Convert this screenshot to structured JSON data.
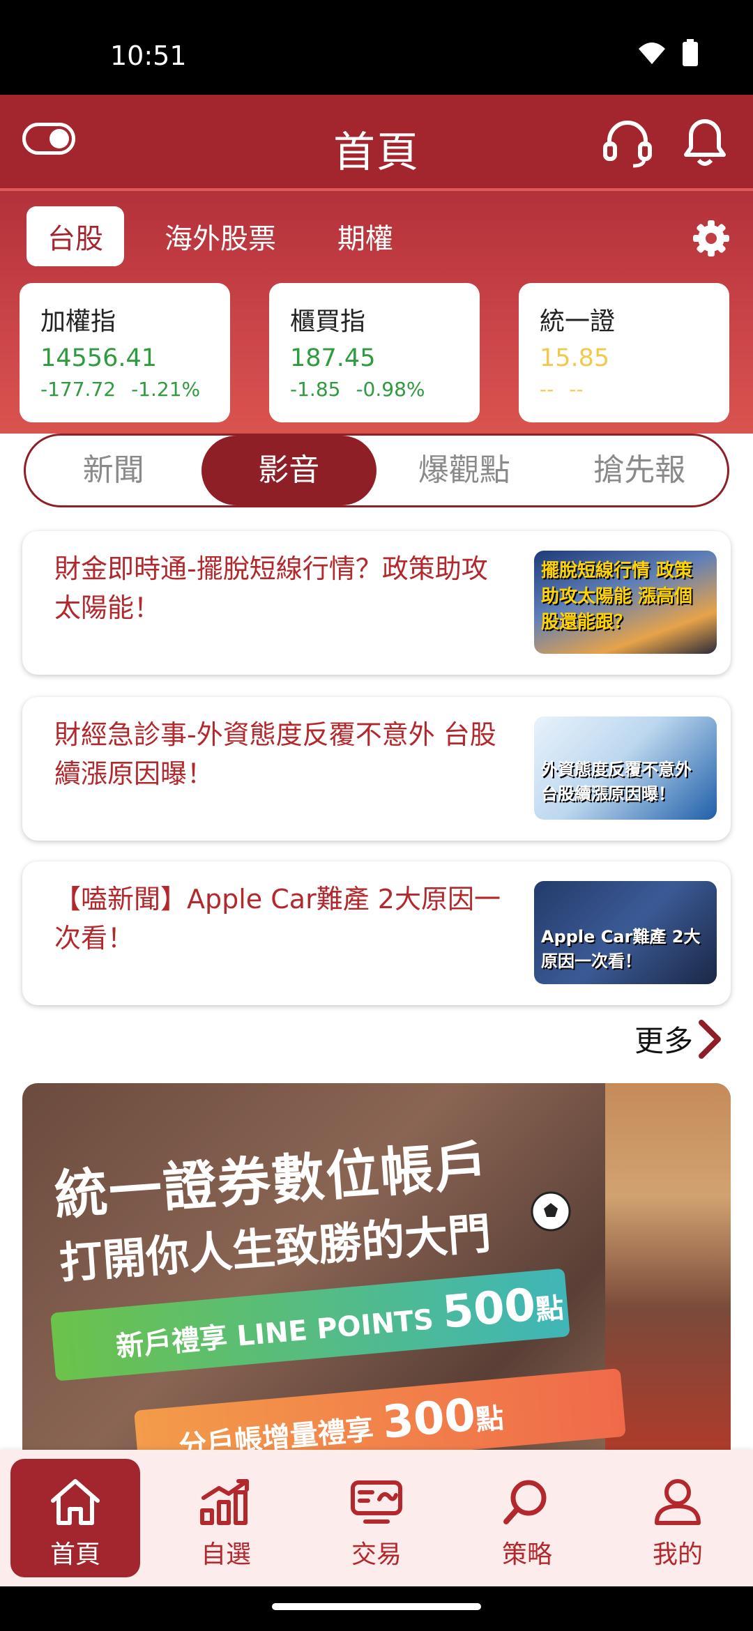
{
  "status_bar": {
    "time": "10:51"
  },
  "header": {
    "title": "首頁"
  },
  "market_tabs": [
    "台股",
    "海外股票",
    "期權"
  ],
  "index_cards": [
    {
      "name": "加權指",
      "price": "14556.41",
      "change": "-177.72",
      "percent": "-1.21%"
    },
    {
      "name": "櫃買指",
      "price": "187.45",
      "change": "-1.85",
      "percent": "-0.98%"
    },
    {
      "name": "統一證",
      "price": "15.85",
      "change": "--",
      "percent": "--"
    }
  ],
  "content_tabs": [
    "新聞",
    "影音",
    "爆觀點",
    "搶先報"
  ],
  "news": [
    {
      "title": "財金即時通-擺脫短線行情？政策助攻太陽能！",
      "thumb_caption": "擺脫短線行情 政策助攻太陽能 漲高個股還能跟？"
    },
    {
      "title": "財經急診事-外資態度反覆不意外 台股續漲原因曝！",
      "thumb_caption": "外資態度反覆不意外 台股續漲原因曝！"
    },
    {
      "title": "【嗑新聞】Apple Car難產 2大原因一次看！",
      "thumb_caption": "Apple Car難產 2大原因一次看！"
    }
  ],
  "more_label": "更多",
  "banner": {
    "line1": "統一證券數位帳戶",
    "line2": "打開你人生致勝的大門",
    "ribbon1_text": "新戶禮享 LINE POINTS",
    "ribbon1_points": "500",
    "ribbon1_unit": "點",
    "ribbon2_text": "分戶帳增量禮享",
    "ribbon2_points": "300",
    "ribbon2_unit": "點"
  },
  "bottom_nav": [
    "首頁",
    "自選",
    "交易",
    "策略",
    "我的"
  ],
  "colors": {
    "brand": "#a3262e",
    "up_down_green": "#2e9b3e",
    "neutral_yellow": "#f2c94c"
  }
}
